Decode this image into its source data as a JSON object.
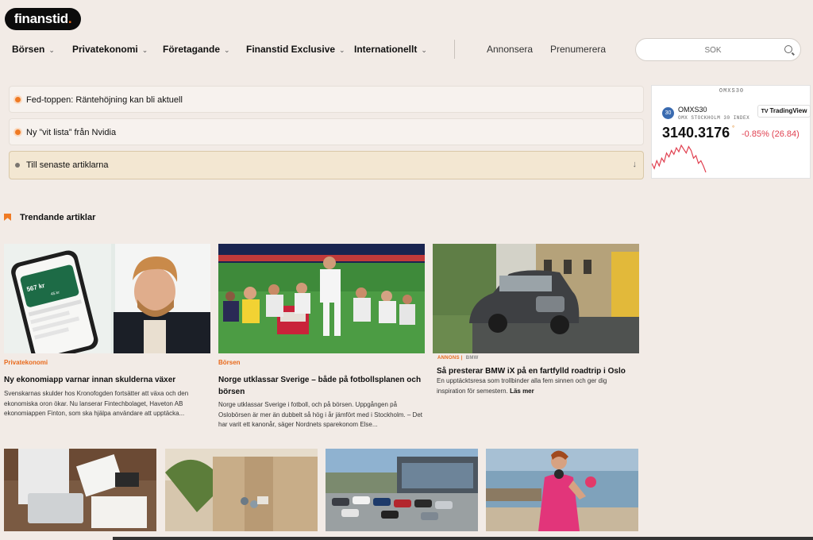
{
  "brand": {
    "logo_text": "finanstid",
    "logo_dot": "."
  },
  "nav": {
    "items": [
      {
        "label": "Börsen"
      },
      {
        "label": "Privatekonomi"
      },
      {
        "label": "Företagande"
      },
      {
        "label": "Finanstid Exclusive"
      },
      {
        "label": "Internationellt"
      }
    ],
    "annonsera": "Annonsera",
    "prenumerera": "Prenumerera",
    "search_placeholder": "SÖK"
  },
  "headlines": [
    {
      "text": "Fed-toppen: Räntehöjning kan bli aktuell"
    },
    {
      "text": "Ny ”vit lista” från Nvidia"
    }
  ],
  "latest": {
    "text": "Till senaste artiklarna",
    "arrow": "↓"
  },
  "widget": {
    "title": "OMXS30",
    "badge": "30",
    "symbol": "OMXS30",
    "subtitle": "OMX STOCKHOLM 30 INDEX",
    "provider": "TradingView",
    "price": "3140.3176",
    "change": "-0.85% (26.84)",
    "sparkline": [
      62,
      58,
      64,
      60,
      66,
      63,
      70,
      67,
      72,
      69,
      74,
      71,
      76,
      73,
      70,
      75,
      72,
      66,
      68,
      62,
      64,
      60,
      55
    ]
  },
  "trending": {
    "label": "Trendande artiklar"
  },
  "cards": [
    {
      "category": "Privatekonomi",
      "title": "Ny ekonomiapp varnar innan skulderna växer",
      "text": "Svenskarnas skulder hos Kronofogden fortsätter att växa och den ekonomiska oron ökar. Nu lanserar Fintechbolaget, Haveton AB ekonomiappen Finton, som ska hjälpa användare att upptäcka..."
    },
    {
      "category": "Börsen",
      "title": "Norge utklassar Sverige – både på fotbollsplanen och börsen",
      "text": "Norge utklassar Sverige i fotboll, och på börsen. Uppgången på Oslobörsen är mer än dubbelt så hög i år jämfört med i Stockholm. – Det har varit ett kanonår, säger Nordnets sparekonom Else..."
    },
    {
      "ad_label": "ANNONS",
      "ad_brand": "BMW",
      "title": "Så presterar BMW iX på en fartfylld roadtrip i Oslo",
      "text": "En upptäcktsresa som trollbinder alla fem sinnen och ger dig inspiration för semestern.",
      "read_more": "Läs mer"
    }
  ],
  "phone": {
    "amount": "567 kr",
    "small": "45 kr"
  },
  "colors": {
    "accent": "#e86a1c",
    "background": "#f2ebe6",
    "negative": "#e04050"
  }
}
